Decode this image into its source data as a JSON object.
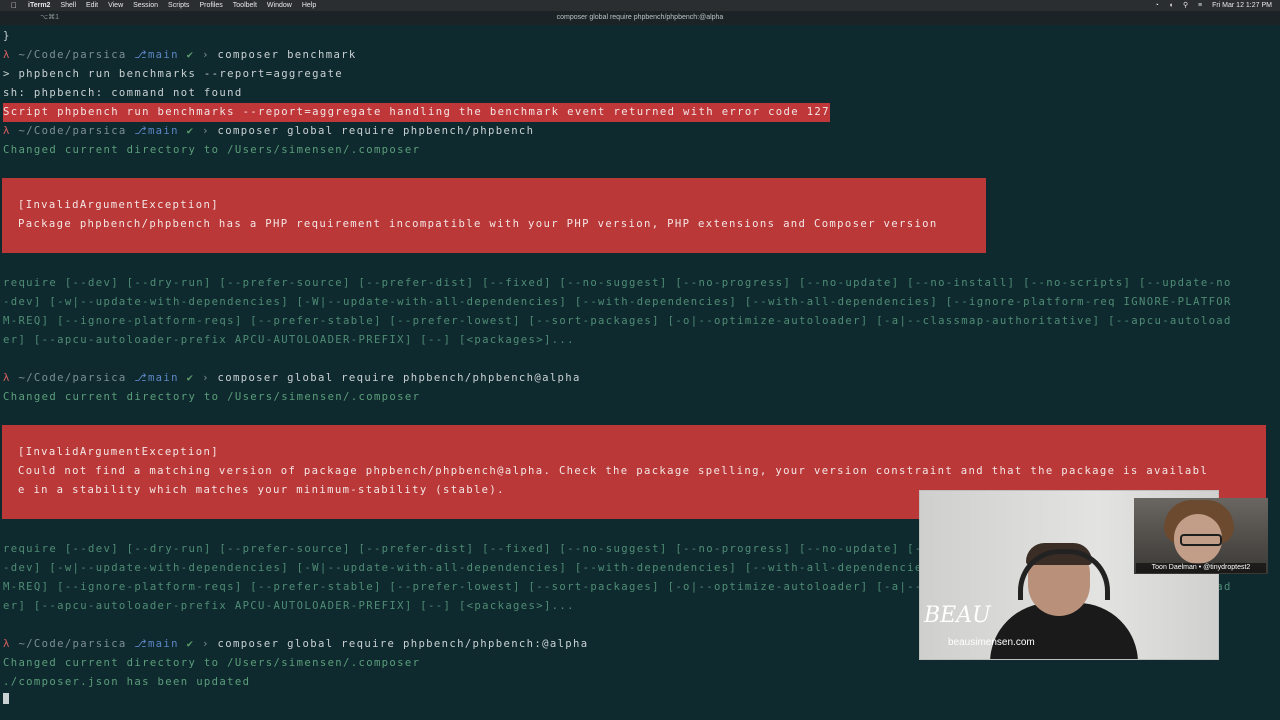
{
  "menubar": {
    "apple_icon": "apple-logo",
    "items": [
      "iTerm2",
      "Shell",
      "Edit",
      "View",
      "Session",
      "Scripts",
      "Profiles",
      "Toolbelt",
      "Window",
      "Help"
    ],
    "clock": "Fri Mar 12  1:27 PM"
  },
  "window": {
    "tab": "⌥⌘1",
    "title": "composer global require phpbench/phpbench:@alpha"
  },
  "prompt": {
    "lambda": "λ",
    "path": " ~/Code/parsica ",
    "git_icon": "",
    "branch": "main",
    "check": " ✔",
    "arrow": " › "
  },
  "terminal": {
    "brace": "}",
    "cmd1": "composer benchmark",
    "out1": "> phpbench run benchmarks --report=aggregate",
    "out2": "sh: phpbench: command not found",
    "err1": "Script phpbench run benchmarks --report=aggregate handling the benchmark event returned with error code 127",
    "cmd2": "composer global require phpbench/phpbench",
    "cd": "Changed current directory to /Users/simensen/.composer",
    "box1": {
      "title": "[InvalidArgumentException]",
      "msg": "Package phpbench/phpbench has a PHP requirement incompatible with your PHP version, PHP extensions and Composer version"
    },
    "usage": [
      "require [--dev] [--dry-run] [--prefer-source] [--prefer-dist] [--fixed] [--no-suggest] [--no-progress] [--no-update] [--no-install] [--no-scripts] [--update-no",
      "-dev] [-w|--update-with-dependencies] [-W|--update-with-all-dependencies] [--with-dependencies] [--with-all-dependencies] [--ignore-platform-req IGNORE-PLATFOR",
      "M-REQ] [--ignore-platform-reqs] [--prefer-stable] [--prefer-lowest] [--sort-packages] [-o|--optimize-autoloader] [-a|--classmap-authoritative] [--apcu-autoload",
      "er] [--apcu-autoloader-prefix APCU-AUTOLOADER-PREFIX] [--] [<packages>]..."
    ],
    "cmd3": "composer global require phpbench/phpbench@alpha",
    "box2": {
      "title": "[InvalidArgumentException]",
      "msg1": "Could not find a matching version of package phpbench/phpbench@alpha. Check the package spelling, your version constraint and that the package is availabl",
      "msg2": "e in a stability which matches your minimum-stability (stable)."
    },
    "cmd4": "composer global require phpbench/phpbench:@alpha",
    "updated": "./composer.json has been updated"
  },
  "webcam": {
    "host_logo": "BEAU",
    "host_site": "beausimensen.com",
    "guest_caption": "Toon Daelman • @tinydroptest2"
  },
  "colors": {
    "terminal_bg": "#0f2a2f",
    "error_bg": "#bb3838",
    "green_text": "#5b9e7a",
    "branch_blue": "#5b86c4",
    "lambda_red": "#d95f5f"
  }
}
